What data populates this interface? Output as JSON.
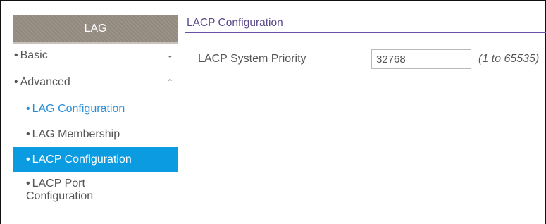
{
  "sidebar": {
    "header": "LAG",
    "items": [
      {
        "label": "Basic",
        "bullet": "•",
        "chevron": "⌄"
      },
      {
        "label": "Advanced",
        "bullet": "•",
        "chevron": "⌃"
      },
      {
        "label": "LAG Configuration",
        "bullet": "•"
      },
      {
        "label": "LAG Membership",
        "bullet": "•"
      },
      {
        "label": "LACP Configuration",
        "bullet": "•"
      },
      {
        "label": "LACP Port",
        "label_line2": "Configuration",
        "bullet": "•"
      }
    ]
  },
  "main": {
    "tab_title": "LACP Configuration",
    "fields": [
      {
        "label": "LACP System Priority",
        "value": "32768",
        "range": "(1 to 65535)"
      }
    ]
  }
}
